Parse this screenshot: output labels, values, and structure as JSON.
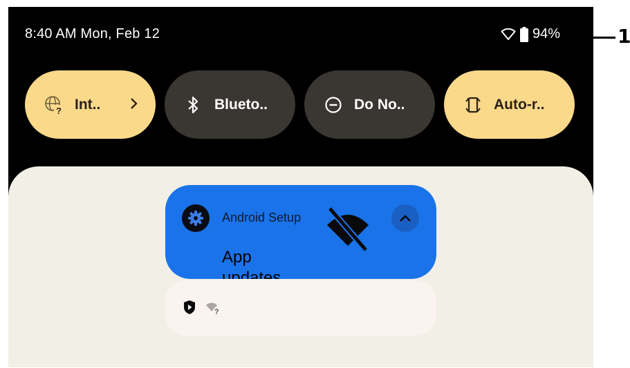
{
  "status_bar": {
    "time_date": "8:40 AM Mon, Feb 12",
    "battery_percent": "94%",
    "icons": [
      "wifi-icon",
      "battery-icon"
    ]
  },
  "quick_tiles": [
    {
      "label": "Int..",
      "icon": "internet-icon",
      "state": "on",
      "has_chevron": true
    },
    {
      "label": "Blueto..",
      "icon": "bluetooth-icon",
      "state": "off"
    },
    {
      "label": "Do No..",
      "icon": "do-not-disturb-icon",
      "state": "off"
    },
    {
      "label": "Auto-r..",
      "icon": "auto-rotate-icon",
      "state": "on"
    }
  ],
  "notification": {
    "app_name": "Android Setup",
    "title": "App updates",
    "icons": [
      "settings-gear-icon",
      "wifi-off-icon",
      "chevron-up-icon"
    ]
  },
  "notification_2": {
    "icons": [
      "play-protect-icon",
      "wifi-unknown-icon"
    ]
  },
  "callout": {
    "number": "1"
  },
  "colors": {
    "tile_on": "#fbd98a",
    "tile_off": "#3a3632",
    "notification_bg": "#1a73e8",
    "shade_bg": "#f2efe7"
  }
}
